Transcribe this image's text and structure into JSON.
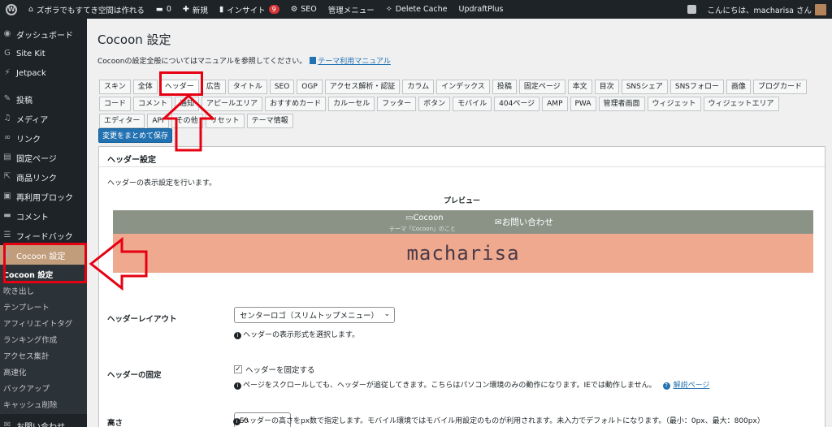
{
  "adminbar": {
    "site_name": "ズボラでもすてき空間は作れる",
    "comments_count": "0",
    "new_label": "新規",
    "insights_label": "インサイト",
    "insights_badge": "9",
    "seo_label": "SEO",
    "admin_menu_label": "管理メニュー",
    "delete_cache_label": "Delete Cache",
    "updraft_label": "UpdraftPlus",
    "greeting": "こんにちは、macharisa さん"
  },
  "sidebar": {
    "items": [
      {
        "label": "ダッシュボード",
        "icon": "dashboard-icon",
        "glyph": "◉"
      },
      {
        "label": "Site Kit",
        "icon": "sitekit-icon",
        "glyph": "G"
      },
      {
        "label": "Jetpack",
        "icon": "jetpack-icon",
        "glyph": "⚡"
      },
      {
        "label": "投稿",
        "icon": "pin-icon",
        "glyph": "✎"
      },
      {
        "label": "メディア",
        "icon": "media-icon",
        "glyph": "♫"
      },
      {
        "label": "リンク",
        "icon": "link-icon",
        "glyph": "∞"
      },
      {
        "label": "固定ページ",
        "icon": "page-icon",
        "glyph": "▤"
      },
      {
        "label": "商品リンク",
        "icon": "product-link-icon",
        "glyph": "⇱"
      },
      {
        "label": "再利用ブロック",
        "icon": "block-icon",
        "glyph": "▣"
      },
      {
        "label": "コメント",
        "icon": "comment-icon",
        "glyph": "▬"
      },
      {
        "label": "フィードバック",
        "icon": "feedback-icon",
        "glyph": "☰"
      },
      {
        "label": "Cocoon 設定",
        "icon": "cocoon-icon",
        "glyph": "◐"
      }
    ],
    "submenu": [
      "Cocoon 設定",
      "吹き出し",
      "テンプレート",
      "アフィリエイトタグ",
      "ランキング作成",
      "アクセス集計",
      "高速化",
      "バックアップ",
      "キャッシュ削除"
    ],
    "partial_item": "お問い合わせ"
  },
  "main": {
    "title": "Cocoon 設定",
    "intro_text": "Cocoonの設定全般についてはマニュアルを参照してください。",
    "manual_link": "テーマ利用マニュアル",
    "tabs_row1": [
      "スキン",
      "全体",
      "ヘッダー",
      "広告",
      "タイトル",
      "SEO",
      "OGP",
      "アクセス解析・認証",
      "カラム",
      "インデックス",
      "投稿",
      "固定ページ",
      "本文",
      "目次",
      "SNSシェア",
      "SNSフォロー",
      "画像",
      "ブログカード"
    ],
    "tabs_row2": [
      "コード",
      "コメント",
      "通知",
      "アピールエリア",
      "おすすめカード",
      "カルーセル",
      "フッター",
      "ボタン",
      "モバイル",
      "404ページ",
      "AMP",
      "PWA",
      "管理者画面",
      "ウィジェット",
      "ウィジェットエリア"
    ],
    "tabs_row3": [
      "エディター",
      "API",
      "その他",
      "リセット",
      "テーマ情報"
    ],
    "active_tab": "ヘッダー",
    "save_label": "変更をまとめて保存",
    "panel_title": "ヘッダー設定",
    "panel_desc": "ヘッダーの表示設定を行います。",
    "preview_label": "プレビュー",
    "preview": {
      "site_item": "Cocoon",
      "site_tagline": "テーマ「Cocoon」のこと",
      "contact_item": "お問い合わせ",
      "logo_text": "macharisa",
      "top_color": "#8b9387",
      "bottom_color": "#eea98f"
    },
    "layout": {
      "label": "ヘッダーレイアウト",
      "selected": "センターロゴ（スリムトップメニュー）",
      "help": "ヘッダーの表示形式を選択します。"
    },
    "fixed": {
      "label": "ヘッダーの固定",
      "checkbox_label": "ヘッダーを固定する",
      "checked": true,
      "help": "ページをスクロールしても、ヘッダーが追従してきます。こちらはパソコン環境のみの動作になります。IEでは動作しません。",
      "help_link": "解説ページ"
    },
    "height": {
      "label": "高さ",
      "value": "50",
      "help": "ヘッダーの高さをpx数で指定します。モバイル環境ではモバイル用設定のものが利用されます。未入力でデフォルトになります。（最小：0px、最大：800px）"
    }
  },
  "colors": {
    "accent": "#2271b1",
    "annotation_red": "#e60012",
    "menu_active": "#c19d7b"
  }
}
